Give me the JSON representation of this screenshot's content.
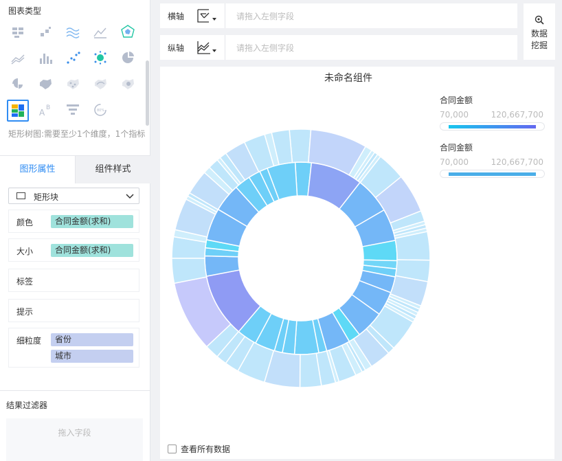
{
  "left_panel": {
    "chart_types_title": "图表类型",
    "hint": "矩形树图:需要至少1个维度，1个指标",
    "chart_types": [
      {
        "name": "cross-table-icon"
      },
      {
        "name": "grouped-table-icon"
      },
      {
        "name": "wave-line-icon"
      },
      {
        "name": "area-line-icon"
      },
      {
        "name": "radar-icon"
      },
      {
        "name": "multi-line-icon"
      },
      {
        "name": "bar-chart-icon"
      },
      {
        "name": "scatter-icon"
      },
      {
        "name": "bubble-icon"
      },
      {
        "name": "pie-chart-icon"
      },
      {
        "name": "rose-chart-icon"
      },
      {
        "name": "region-map-icon"
      },
      {
        "name": "point-map-icon"
      },
      {
        "name": "flow-map-icon"
      },
      {
        "name": "heat-map-icon"
      },
      {
        "name": "treemap-icon",
        "selected": true
      },
      {
        "name": "word-cloud-icon"
      },
      {
        "name": "funnel-icon"
      },
      {
        "name": "gauge-icon"
      }
    ],
    "tabs": {
      "active": "图形属性",
      "other": "组件样式"
    },
    "shape_select": {
      "value": "矩形块"
    },
    "props": {
      "color": {
        "label": "颜色",
        "field": "合同金额(求和)"
      },
      "size": {
        "label": "大小",
        "field": "合同金额(求和)"
      },
      "label": {
        "label": "标签"
      },
      "tooltip": {
        "label": "提示"
      },
      "granularity": {
        "label": "细粒度",
        "fields": [
          "省份",
          "城市"
        ]
      }
    },
    "filter": {
      "title": "结果过滤器",
      "placeholder": "拖入字段"
    }
  },
  "axes": {
    "x": {
      "label": "横轴",
      "placeholder": "请拖入左侧字段"
    },
    "y": {
      "label": "纵轴",
      "placeholder": "请拖入左侧字段"
    }
  },
  "mining": {
    "line1": "数据",
    "line2": "挖掘"
  },
  "chart": {
    "title": "未命名组件",
    "legends": [
      {
        "title": "合同金额",
        "min": "70,000",
        "max": "120,667,700",
        "gradient": [
          "#17c6ee",
          "#6368f0"
        ]
      },
      {
        "title": "合同金额",
        "min": "70,000",
        "max": "120,667,700",
        "gradient": [
          "#4aaee8",
          "#4aaee8"
        ]
      }
    ],
    "show_all_label": "查看所有数据"
  },
  "chart_data": {
    "type": "sunburst",
    "inner_values": [
      4,
      13,
      9,
      8,
      5,
      2,
      2,
      4,
      6,
      7,
      3,
      6,
      2,
      6,
      3,
      2,
      5,
      5,
      16,
      5,
      2,
      2,
      8,
      7,
      4,
      3,
      2,
      7
    ],
    "inner_colors": [
      "#6ecff8",
      "#8da4f4",
      "#74b7f7",
      "#74b7f7",
      "#5ed9f6",
      "#72d6f8",
      "#6ecff8",
      "#74b7f7",
      "#74b7f7",
      "#74b7f7",
      "#5ed9f6",
      "#74b7f7",
      "#6ecff8",
      "#6ecff8",
      "#6ecff8",
      "#6ecff8",
      "#6ecff8",
      "#6ecff8",
      "#8f9bf4",
      "#74b7f7",
      "#6ecff8",
      "#5ed9f6",
      "#74b7f7",
      "#74b7f7",
      "#6ecff8",
      "#6ecff8",
      "#6ecff8",
      "#6ecff8"
    ],
    "outer_values": [
      6,
      16,
      2,
      1,
      1,
      1,
      8,
      11,
      3,
      1,
      1,
      1,
      8,
      6,
      7,
      1,
      1,
      1,
      1,
      1,
      9,
      2,
      6,
      2,
      1,
      2,
      5,
      1,
      4,
      6,
      10,
      8,
      4,
      3,
      4,
      20,
      7,
      6,
      2,
      9,
      1,
      1,
      7,
      2,
      3,
      1,
      2,
      6,
      6,
      2,
      5
    ],
    "outer_colors": [
      "#bfe6fb",
      "#c2d5fa",
      "#cfeefc",
      "#cfeefc",
      "#bfe6fb",
      "#cfeefc",
      "#bfe6fb",
      "#c2d5fa",
      "#bfe6fb",
      "#cfeefc",
      "#bfe6fb",
      "#cfeefc",
      "#bfe6fb",
      "#bfe6fb",
      "#c2dffa",
      "#cfeefc",
      "#bfe6fb",
      "#cfeefc",
      "#bfe6fb",
      "#cfeefc",
      "#bfe6fb",
      "#bfe6fb",
      "#c2dffa",
      "#cfeefc",
      "#bfe6fb",
      "#cfeefc",
      "#bfe6fb",
      "#cfeefc",
      "#bfe6fb",
      "#bfe6fb",
      "#c2dffa",
      "#bfe6fb",
      "#bfe6fb",
      "#bfe6fb",
      "#bfe6fb",
      "#c6c9fb",
      "#bfe6fb",
      "#bfe6fb",
      "#cfeefc",
      "#c2dffa",
      "#cfeefc",
      "#bfe6fb",
      "#c2dffa",
      "#cfeefc",
      "#bfe6fb",
      "#cfeefc",
      "#bfe6fb",
      "#c2dffa",
      "#bfe6fb",
      "#cfeefc",
      "#bfe6fb"
    ]
  }
}
